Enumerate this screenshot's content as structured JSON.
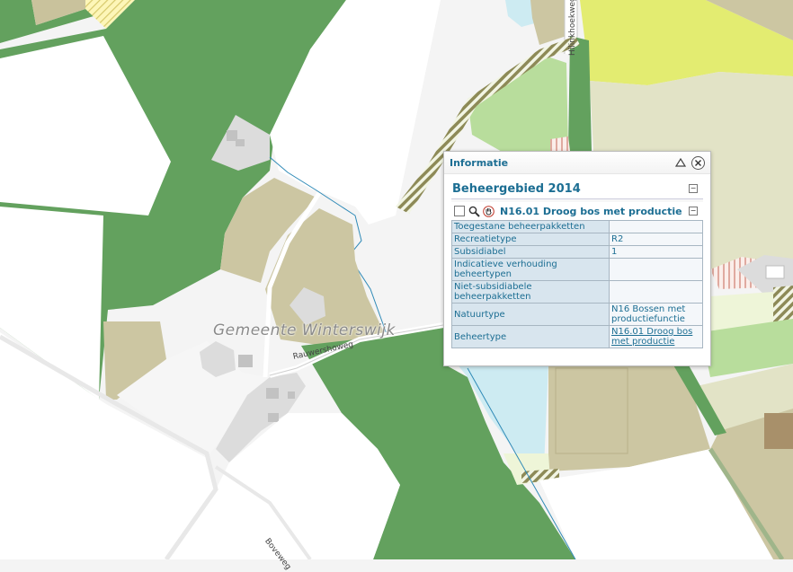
{
  "map": {
    "municipality_label": "Gemeente  Winterswijk",
    "road_labels": [
      "Rauwershoweg",
      "Boveweg",
      "Hilinkhoekweg"
    ]
  },
  "colors": {
    "forest": "#63a15e",
    "arable": "#ccc6a2",
    "built": "#dcdcdc",
    "background": "#f4f4f4",
    "water": "#cdebf2",
    "grassland": "#b8dd9c",
    "yellow_zone": "#e3ec71",
    "panel_text": "#1c6e93"
  },
  "popup": {
    "title": "Informatie",
    "collapse_icon": "triangle-up-icon",
    "close_icon": "close-circle-icon",
    "section_title": "Beheergebied 2014",
    "feature_title": "N16.01 Droog bos met productie",
    "tools": [
      "checkbox",
      "zoom-icon",
      "pan-hand-icon"
    ],
    "rows": [
      {
        "key": "Toegestane beheerpakketten",
        "value": ""
      },
      {
        "key": "Recreatietype",
        "value": "R2"
      },
      {
        "key": "Subsidiabel",
        "value": "1"
      },
      {
        "key": "Indicatieve verhouding beheertypen",
        "value": ""
      },
      {
        "key": "Niet-subsidiabele beheerpakketten",
        "value": ""
      },
      {
        "key": "Natuurtype",
        "value": "N16 Bossen met productiefunctie"
      },
      {
        "key": "Beheertype",
        "value": "N16.01 Droog bos met productie"
      }
    ]
  }
}
